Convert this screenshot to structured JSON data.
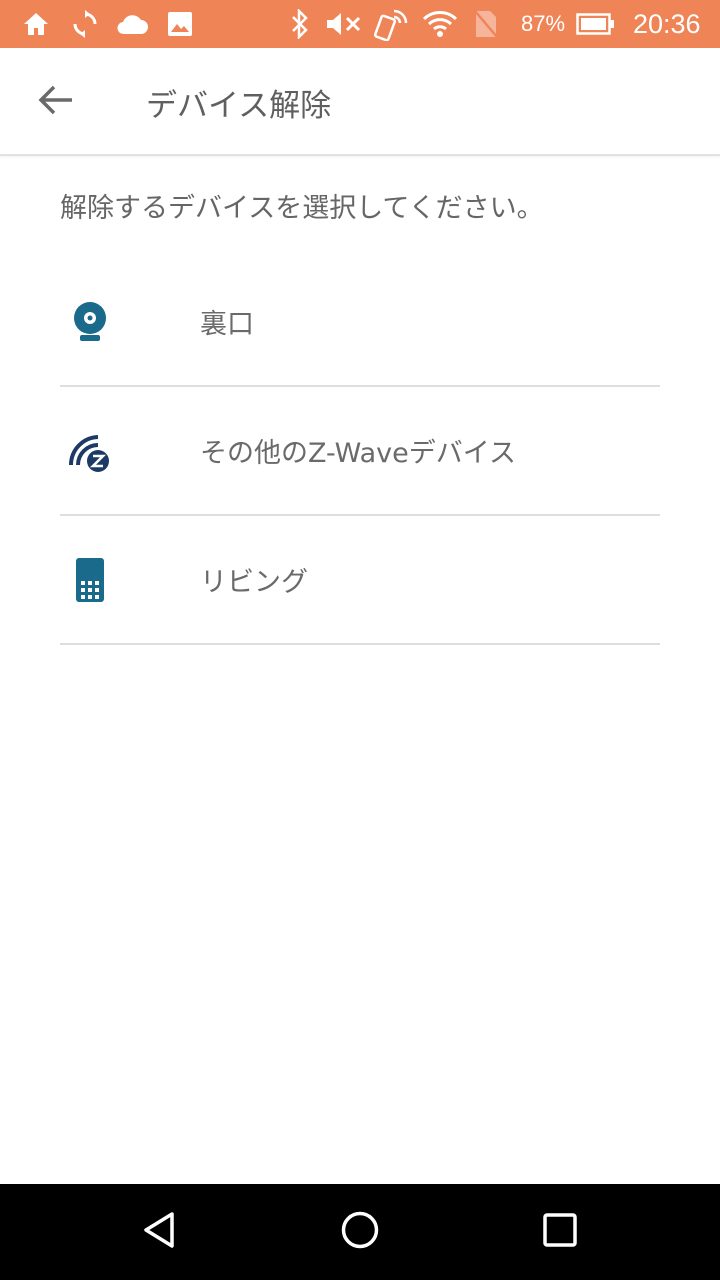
{
  "status_bar": {
    "battery_percent": "87%",
    "time": "20:36",
    "icons": [
      "home-icon",
      "sync-icon",
      "cloud-icon",
      "image-icon",
      "bluetooth-icon",
      "mute-icon",
      "nfc-icon",
      "wifi-icon",
      "no-sim-icon",
      "battery-icon"
    ]
  },
  "app_bar": {
    "title": "デバイス解除",
    "back_icon": "arrow-back-icon"
  },
  "instruction": "解除するデバイスを選択してください。",
  "devices": [
    {
      "label": "裏口",
      "icon": "camera-icon"
    },
    {
      "label": "その他のZ-Waveデバイス",
      "icon": "zwave-icon"
    },
    {
      "label": "リビング",
      "icon": "keypad-icon"
    }
  ],
  "colors": {
    "status_bar": "#ef8457",
    "icon_teal": "#1a6a8c",
    "zwave_navy": "#1d3a66"
  },
  "nav_bar": {
    "buttons": [
      "back-triangle-icon",
      "home-circle-icon",
      "recents-square-icon"
    ]
  }
}
